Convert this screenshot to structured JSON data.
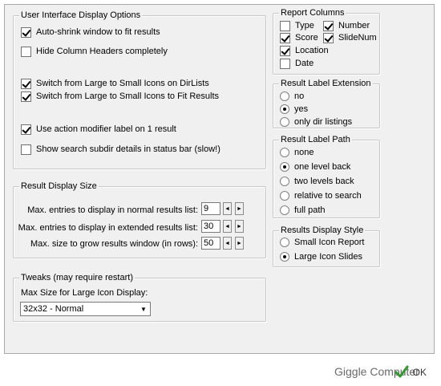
{
  "ui_group": {
    "title": "User Interface Display Options",
    "options": [
      {
        "label": "Auto-shrink window to fit results",
        "checked": true
      },
      {
        "label": "Hide Column Headers completely",
        "checked": false
      },
      {
        "label": "Switch from Large to Small Icons on DirLists",
        "checked": true
      },
      {
        "label": "Switch from Large to Small Icons to Fit Results",
        "checked": true
      },
      {
        "label": "Use action modifier label on 1 result",
        "checked": true
      },
      {
        "label": "Show search subdir details in status bar (slow!)",
        "checked": false
      }
    ]
  },
  "size_group": {
    "title": "Result Display Size",
    "rows": [
      {
        "label": "Max. entries to display in normal results list:",
        "value": "9"
      },
      {
        "label": "Max. entries to display in extended results list:",
        "value": "30"
      },
      {
        "label": "Max. size to grow results window (in rows):",
        "value": "50"
      }
    ],
    "spin_left": "◄",
    "spin_right": "►"
  },
  "tweaks_group": {
    "title": "Tweaks (may require restart)",
    "combo_label": "Max Size for Large Icon Display:",
    "combo_value": "32x32 - Normal",
    "combo_arrow": "▼"
  },
  "report_columns": {
    "title": "Report Columns",
    "items": [
      {
        "label": "Type",
        "checked": false
      },
      {
        "label": "Number",
        "checked": true
      },
      {
        "label": "Score",
        "checked": true
      },
      {
        "label": "SlideNum",
        "checked": true
      },
      {
        "label": "Location",
        "checked": true
      },
      {
        "label": "Date",
        "checked": false
      }
    ]
  },
  "label_extension": {
    "title": "Result Label Extension",
    "options": [
      {
        "label": "no",
        "selected": false
      },
      {
        "label": "yes",
        "selected": true
      },
      {
        "label": "only dir listings",
        "selected": false
      }
    ]
  },
  "label_path": {
    "title": "Result Label Path",
    "options": [
      {
        "label": "none",
        "selected": false
      },
      {
        "label": "one level back",
        "selected": true
      },
      {
        "label": "two levels back",
        "selected": false
      },
      {
        "label": "relative to search",
        "selected": false
      },
      {
        "label": "full path",
        "selected": false
      }
    ]
  },
  "display_style": {
    "title": "Results Display Style",
    "options": [
      {
        "label": "Small Icon Report",
        "selected": false
      },
      {
        "label": "Large Icon Slides",
        "selected": true
      }
    ]
  },
  "footer": {
    "app_label": "Giggle Computer",
    "ok_label": "OK",
    "ok_icon": "checkmark-icon",
    "ok_icon_color": "#2e9a2e"
  }
}
